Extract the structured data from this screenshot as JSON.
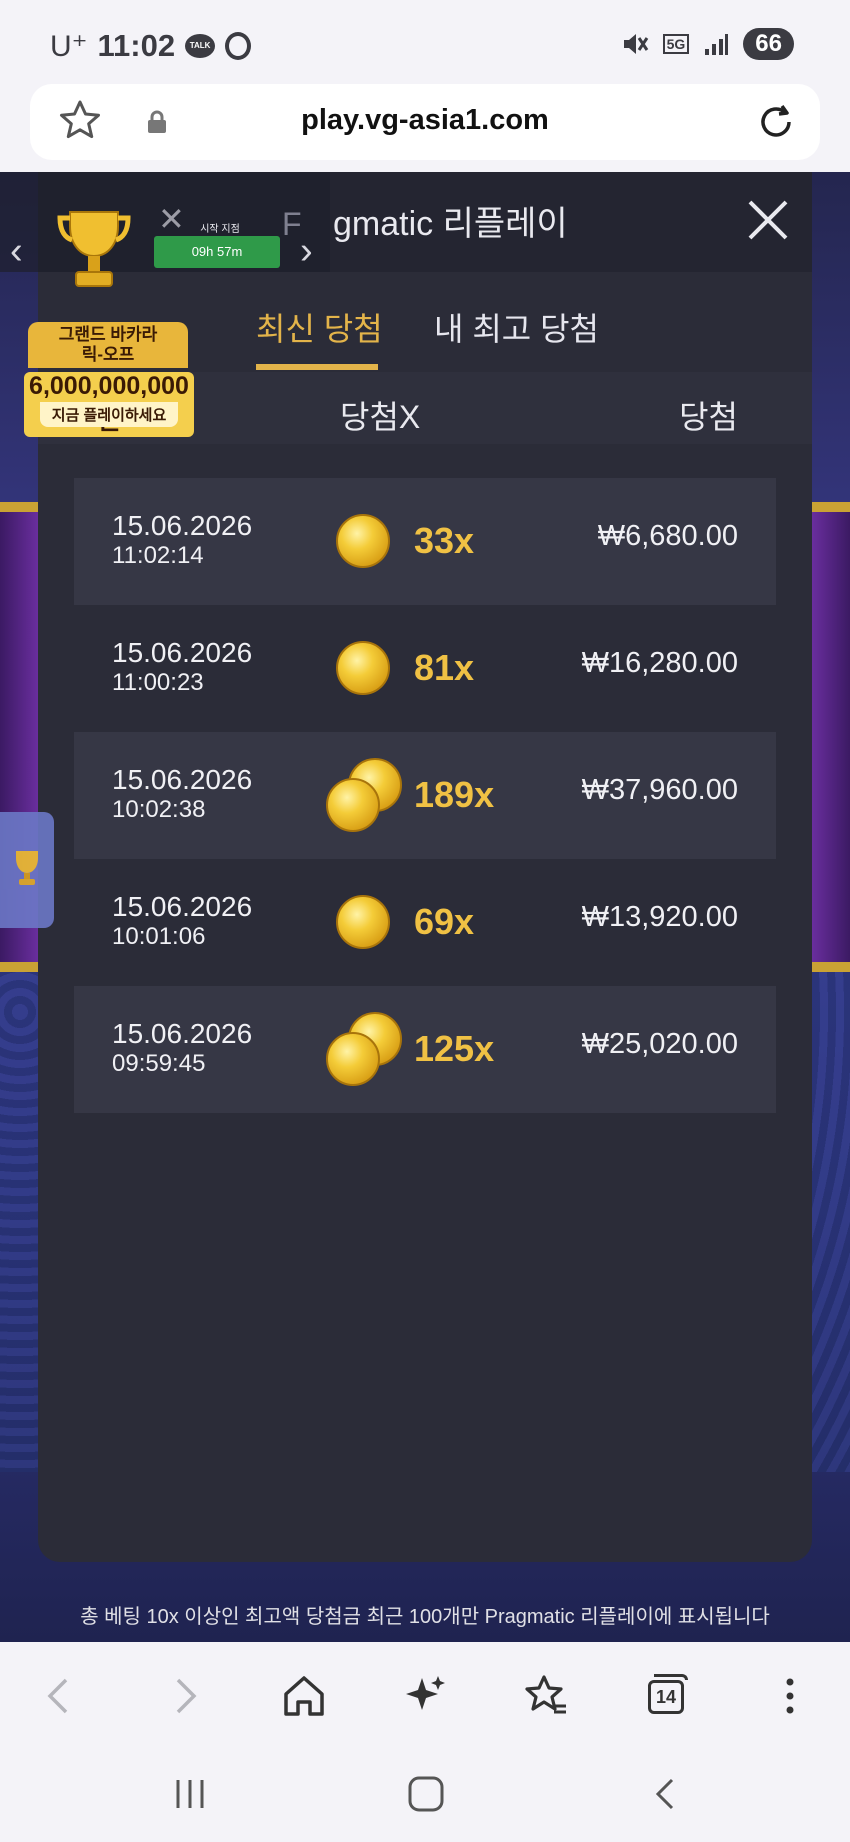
{
  "status_bar": {
    "carrier": "U⁺",
    "time": "11:02",
    "talk_badge": "TALK",
    "network": "5G",
    "battery": "66"
  },
  "browser": {
    "url": "play.vg-asia1.com",
    "tabs_count": "14"
  },
  "panel": {
    "title": "gmatic 리플레이",
    "tabs": [
      {
        "label": "최신 당첨",
        "active": true
      },
      {
        "label": "내 최고 당첨",
        "active": false
      }
    ],
    "columns": {
      "time": "시간",
      "multiplier": "당첨X",
      "win": "당첨"
    },
    "rows": [
      {
        "date": "15.06.2026",
        "time": "11:02:14",
        "coins": 1,
        "multiplier": "33x",
        "win": "₩6,680.00"
      },
      {
        "date": "15.06.2026",
        "time": "11:00:23",
        "coins": 1,
        "multiplier": "81x",
        "win": "₩16,280.00"
      },
      {
        "date": "15.06.2026",
        "time": "10:02:38",
        "coins": 2,
        "multiplier": "189x",
        "win": "₩37,960.00"
      },
      {
        "date": "15.06.2026",
        "time": "10:01:06",
        "coins": 1,
        "multiplier": "69x",
        "win": "₩13,920.00"
      },
      {
        "date": "15.06.2026",
        "time": "09:59:45",
        "coins": 2,
        "multiplier": "125x",
        "win": "₩25,020.00"
      }
    ],
    "footnote": "총 베팅 10x 이상인 최고액 당첨금 최근 100개만 Pragmatic 리플레이에 표시됩니다"
  },
  "promo": {
    "start_label": "시작 지점",
    "timer": "09h 57m",
    "title_line1": "그랜드 바카라",
    "title_line2": "릭-오프",
    "amount": "6,000,000,000원",
    "cta": "지금 플레이하세요",
    "letter": "F"
  },
  "colors": {
    "accent": "#e3b44a",
    "panel_bg": "#2b2c38",
    "row_shade": "#363745",
    "timer_green": "#2f9a49"
  },
  "icons": {
    "bookmark": "star-outline-icon",
    "lock": "lock-icon",
    "reload": "reload-icon",
    "close": "close-icon",
    "coin": "gold-coin-icon",
    "trophy": "trophy-icon"
  }
}
